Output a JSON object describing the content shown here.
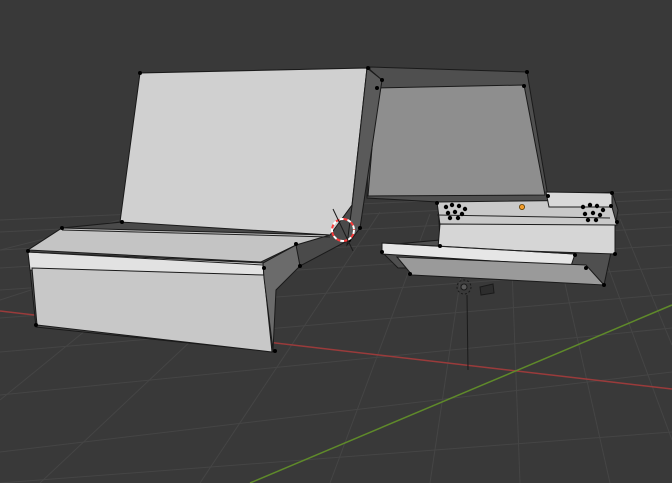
{
  "viewport": {
    "mode": "Edit Mode",
    "shading": "Solid",
    "background_color": "#393939",
    "grid_color": "#454545",
    "x_axis_color": "#9a3b3b",
    "y_axis_color": "#5f8a2a"
  },
  "scene": {
    "object": "mesh",
    "selection": "none",
    "vertex_color": "#000000",
    "edge_color": "#000000",
    "face_light": "#d4d4d4",
    "face_mid": "#c7c7c7",
    "face_shadow": "#575757",
    "origin_color": "#f29c2b",
    "cursor_colors": [
      "#ff3b3b",
      "#ffffff"
    ]
  },
  "icons": [
    "3d-cursor-icon",
    "light-object-icon",
    "camera-object-icon",
    "object-origin-icon"
  ]
}
